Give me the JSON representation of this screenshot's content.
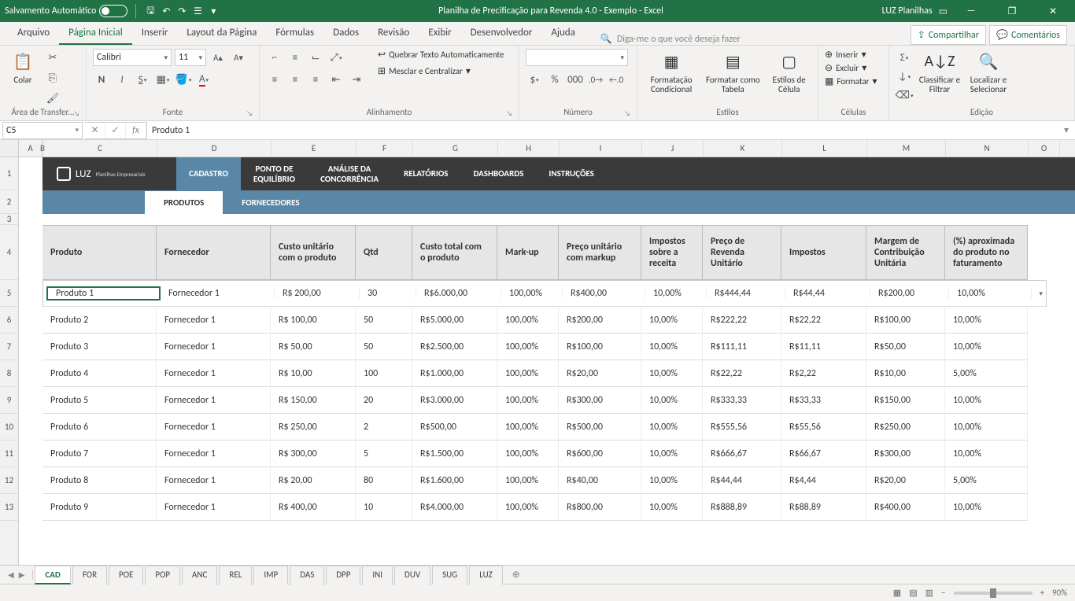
{
  "titlebar": {
    "autosave": "Salvamento Automático",
    "title": "Planilha de Precificação para Revenda 4.0 - Exemplo  -  Excel",
    "user": "LUZ Planilhas"
  },
  "ribbon_tabs": [
    "Arquivo",
    "Página Inicial",
    "Inserir",
    "Layout da Página",
    "Fórmulas",
    "Dados",
    "Revisão",
    "Exibir",
    "Desenvolvedor",
    "Ajuda"
  ],
  "tellme": "Diga-me o que você deseja fazer",
  "share": "Compartilhar",
  "comments": "Comentários",
  "ribbon": {
    "clipboard": {
      "label": "Área de Transfer...",
      "paste": "Colar"
    },
    "font": {
      "label": "Fonte",
      "name": "Calibri",
      "size": "11"
    },
    "align": {
      "label": "Alinhamento",
      "wrap": "Quebrar Texto Automaticamente",
      "merge": "Mesclar e Centralizar"
    },
    "number": {
      "label": "Número"
    },
    "styles": {
      "label": "Estilos",
      "cond": "Formatação Condicional",
      "table": "Formatar como Tabela",
      "cell": "Estilos de Célula"
    },
    "cells": {
      "label": "Células",
      "insert": "Inserir",
      "delete": "Excluir",
      "format": "Formatar"
    },
    "editing": {
      "label": "Edição",
      "sort": "Classificar e Filtrar",
      "find": "Localizar e Selecionar"
    }
  },
  "namebox": "C5",
  "formula": "Produto 1",
  "cols": [
    "A",
    "B",
    "C",
    "D",
    "E",
    "F",
    "G",
    "H",
    "I",
    "J",
    "K",
    "L",
    "M",
    "N",
    "O"
  ],
  "dashnav": {
    "logo": "LUZ",
    "logosub": "Planilhas Empresariais",
    "items": [
      "CADASTRO",
      "PONTO DE EQUILÍBRIO",
      "ANÁLISE DA CONCORRÊNCIA",
      "RELATÓRIOS",
      "DASHBOARDS",
      "INSTRUÇÕES"
    ]
  },
  "subtabs": [
    "PRODUTOS",
    "FORNECEDORES"
  ],
  "headers": [
    "Produto",
    "Fornecedor",
    "Custo unitário com o produto",
    "Qtd",
    "Custo total com o produto",
    "Mark-up",
    "Preço unitário com markup",
    "Impostos sobre a receita",
    "Preço de Revenda Unitário",
    "Impostos",
    "Margem de Contribuição Unitária",
    "(%) aproximada do produto no faturamento"
  ],
  "rows": [
    [
      "Produto 1",
      "Fornecedor 1",
      "R$ 200,00",
      "30",
      "R$6.000,00",
      "100,00%",
      "R$400,00",
      "10,00%",
      "R$444,44",
      "R$44,44",
      "R$200,00",
      "10,00%"
    ],
    [
      "Produto 2",
      "Fornecedor 1",
      "R$ 100,00",
      "50",
      "R$5.000,00",
      "100,00%",
      "R$200,00",
      "10,00%",
      "R$222,22",
      "R$22,22",
      "R$100,00",
      "10,00%"
    ],
    [
      "Produto 3",
      "Fornecedor 1",
      "R$ 50,00",
      "50",
      "R$2.500,00",
      "100,00%",
      "R$100,00",
      "10,00%",
      "R$111,11",
      "R$11,11",
      "R$50,00",
      "10,00%"
    ],
    [
      "Produto 4",
      "Fornecedor 1",
      "R$ 10,00",
      "100",
      "R$1.000,00",
      "100,00%",
      "R$20,00",
      "10,00%",
      "R$22,22",
      "R$2,22",
      "R$10,00",
      "5,00%"
    ],
    [
      "Produto 5",
      "Fornecedor 1",
      "R$ 150,00",
      "20",
      "R$3.000,00",
      "100,00%",
      "R$300,00",
      "10,00%",
      "R$333,33",
      "R$33,33",
      "R$150,00",
      "10,00%"
    ],
    [
      "Produto 6",
      "Fornecedor 1",
      "R$ 250,00",
      "2",
      "R$500,00",
      "100,00%",
      "R$500,00",
      "10,00%",
      "R$555,56",
      "R$55,56",
      "R$250,00",
      "10,00%"
    ],
    [
      "Produto 7",
      "Fornecedor 1",
      "R$ 300,00",
      "5",
      "R$1.500,00",
      "100,00%",
      "R$600,00",
      "10,00%",
      "R$666,67",
      "R$66,67",
      "R$300,00",
      "10,00%"
    ],
    [
      "Produto 8",
      "Fornecedor 1",
      "R$ 20,00",
      "80",
      "R$1.600,00",
      "100,00%",
      "R$40,00",
      "10,00%",
      "R$44,44",
      "R$4,44",
      "R$20,00",
      "5,00%"
    ],
    [
      "Produto 9",
      "Fornecedor 1",
      "R$ 400,00",
      "10",
      "R$4.000,00",
      "100,00%",
      "R$800,00",
      "10,00%",
      "R$888,89",
      "R$88,89",
      "R$400,00",
      "10,00%"
    ]
  ],
  "rownums": [
    "1",
    "2",
    "3",
    "4",
    "5",
    "6",
    "7",
    "8",
    "9",
    "10",
    "11",
    "12",
    "13"
  ],
  "sheets": [
    "CAD",
    "FOR",
    "POE",
    "POP",
    "ANC",
    "REL",
    "IMP",
    "DAS",
    "DPP",
    "INI",
    "DUV",
    "SUG",
    "LUZ"
  ],
  "zoom": "90%"
}
